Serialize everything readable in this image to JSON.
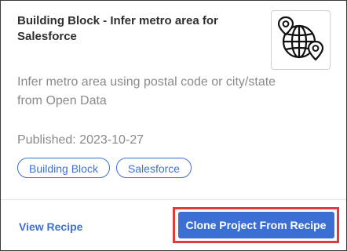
{
  "card": {
    "title": "Building Block - Infer metro area for Salesforce",
    "icon": "globe-map-pins-icon",
    "description": "Infer metro area using postal code or city/state from Open Data",
    "published": "Published: 2023-10-27",
    "tags": [
      "Building Block",
      "Salesforce"
    ],
    "view_link": "View Recipe",
    "clone_button": "Clone Project From Recipe"
  },
  "colors": {
    "accent": "#3d6fd6",
    "button_bg": "#3b6fd4",
    "highlight": "#e23b3b",
    "muted_text": "#8a8a8a"
  }
}
